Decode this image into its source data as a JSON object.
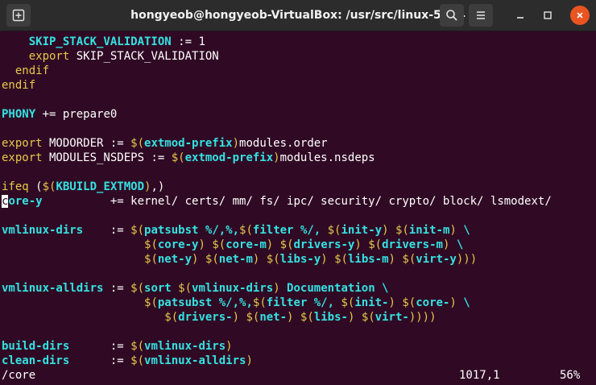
{
  "window": {
    "title": "hongyeob@hongyeob-VirtualBox: /usr/src/linux-5.6.4",
    "icons": [
      "terminal-new-tab-icon",
      "search-icon",
      "menu-icon",
      "minimize-icon",
      "maximize-icon",
      "close-icon"
    ]
  },
  "lines": [
    {
      "segs": [
        {
          "t": "    "
        },
        {
          "t": "SKIP_STACK_VALIDATION",
          "c": "cy"
        },
        {
          "t": " := 1"
        }
      ]
    },
    {
      "segs": [
        {
          "t": "    "
        },
        {
          "t": "export",
          "c": "yl"
        },
        {
          "t": " SKIP_STACK_VALIDATION"
        }
      ]
    },
    {
      "segs": [
        {
          "t": "  "
        },
        {
          "t": "endif",
          "c": "yl"
        }
      ]
    },
    {
      "segs": [
        {
          "t": "endif",
          "c": "yl"
        }
      ]
    },
    {
      "segs": [
        {
          "t": ""
        }
      ]
    },
    {
      "segs": [
        {
          "t": "PHONY",
          "c": "cy"
        },
        {
          "t": " += prepare0"
        }
      ]
    },
    {
      "segs": [
        {
          "t": ""
        }
      ]
    },
    {
      "segs": [
        {
          "t": "export",
          "c": "yl"
        },
        {
          "t": " MODORDER := "
        },
        {
          "t": "$(",
          "c": "yl"
        },
        {
          "t": "extmod-prefix",
          "c": "cy"
        },
        {
          "t": ")",
          "c": "yl"
        },
        {
          "t": "modules.order"
        }
      ]
    },
    {
      "segs": [
        {
          "t": "export",
          "c": "yl"
        },
        {
          "t": " MODULES_NSDEPS := "
        },
        {
          "t": "$(",
          "c": "yl"
        },
        {
          "t": "extmod-prefix",
          "c": "cy"
        },
        {
          "t": ")",
          "c": "yl"
        },
        {
          "t": "modules.nsdeps"
        }
      ]
    },
    {
      "segs": [
        {
          "t": ""
        }
      ]
    },
    {
      "segs": [
        {
          "t": "ifeq",
          "c": "yl"
        },
        {
          "t": " ("
        },
        {
          "t": "$(",
          "c": "yl"
        },
        {
          "t": "KBUILD_EXTMOD",
          "c": "cy"
        },
        {
          "t": ")",
          "c": "yl"
        },
        {
          "t": ",)"
        }
      ]
    },
    {
      "segs": [
        {
          "t": "c",
          "c": "cursor"
        },
        {
          "t": "ore-y",
          "c": "cy"
        },
        {
          "t": "          += kernel/ certs/ mm/ fs/ ipc/ security/ crypto/ block/ lsmodext/"
        }
      ]
    },
    {
      "segs": [
        {
          "t": ""
        }
      ]
    },
    {
      "segs": [
        {
          "t": "vmlinux-dirs",
          "c": "cy"
        },
        {
          "t": "    := "
        },
        {
          "t": "$(",
          "c": "yl"
        },
        {
          "t": "patsubst %/,%,",
          "c": "cy"
        },
        {
          "t": "$(",
          "c": "yl"
        },
        {
          "t": "filter %/, ",
          "c": "cy"
        },
        {
          "t": "$(",
          "c": "yl"
        },
        {
          "t": "init-y",
          "c": "cy"
        },
        {
          "t": ")",
          "c": "yl"
        },
        {
          "t": " "
        },
        {
          "t": "$(",
          "c": "yl"
        },
        {
          "t": "init-m",
          "c": "cy"
        },
        {
          "t": ")",
          "c": "yl"
        },
        {
          "t": " \\",
          "c": "cy"
        }
      ]
    },
    {
      "segs": [
        {
          "t": "                     "
        },
        {
          "t": "$(",
          "c": "yl"
        },
        {
          "t": "core-y",
          "c": "cy"
        },
        {
          "t": ")",
          "c": "yl"
        },
        {
          "t": " "
        },
        {
          "t": "$(",
          "c": "yl"
        },
        {
          "t": "core-m",
          "c": "cy"
        },
        {
          "t": ")",
          "c": "yl"
        },
        {
          "t": " "
        },
        {
          "t": "$(",
          "c": "yl"
        },
        {
          "t": "drivers-y",
          "c": "cy"
        },
        {
          "t": ")",
          "c": "yl"
        },
        {
          "t": " "
        },
        {
          "t": "$(",
          "c": "yl"
        },
        {
          "t": "drivers-m",
          "c": "cy"
        },
        {
          "t": ")",
          "c": "yl"
        },
        {
          "t": " \\",
          "c": "cy"
        }
      ]
    },
    {
      "segs": [
        {
          "t": "                     "
        },
        {
          "t": "$(",
          "c": "yl"
        },
        {
          "t": "net-y",
          "c": "cy"
        },
        {
          "t": ")",
          "c": "yl"
        },
        {
          "t": " "
        },
        {
          "t": "$(",
          "c": "yl"
        },
        {
          "t": "net-m",
          "c": "cy"
        },
        {
          "t": ")",
          "c": "yl"
        },
        {
          "t": " "
        },
        {
          "t": "$(",
          "c": "yl"
        },
        {
          "t": "libs-y",
          "c": "cy"
        },
        {
          "t": ")",
          "c": "yl"
        },
        {
          "t": " "
        },
        {
          "t": "$(",
          "c": "yl"
        },
        {
          "t": "libs-m",
          "c": "cy"
        },
        {
          "t": ")",
          "c": "yl"
        },
        {
          "t": " "
        },
        {
          "t": "$(",
          "c": "yl"
        },
        {
          "t": "virt-y",
          "c": "cy"
        },
        {
          "t": ")))",
          "c": "yl"
        }
      ]
    },
    {
      "segs": [
        {
          "t": ""
        }
      ]
    },
    {
      "segs": [
        {
          "t": "vmlinux-alldirs",
          "c": "cy"
        },
        {
          "t": " := "
        },
        {
          "t": "$(",
          "c": "yl"
        },
        {
          "t": "sort ",
          "c": "cy"
        },
        {
          "t": "$(",
          "c": "yl"
        },
        {
          "t": "vmlinux-dirs",
          "c": "cy"
        },
        {
          "t": ")",
          "c": "yl"
        },
        {
          "t": " Documentation \\",
          "c": "cy"
        }
      ]
    },
    {
      "segs": [
        {
          "t": "                     "
        },
        {
          "t": "$(",
          "c": "yl"
        },
        {
          "t": "patsubst %/,%,",
          "c": "cy"
        },
        {
          "t": "$(",
          "c": "yl"
        },
        {
          "t": "filter %/, ",
          "c": "cy"
        },
        {
          "t": "$(",
          "c": "yl"
        },
        {
          "t": "init-",
          "c": "cy"
        },
        {
          "t": ")",
          "c": "yl"
        },
        {
          "t": " "
        },
        {
          "t": "$(",
          "c": "yl"
        },
        {
          "t": "core-",
          "c": "cy"
        },
        {
          "t": ")",
          "c": "yl"
        },
        {
          "t": " \\",
          "c": "cy"
        }
      ]
    },
    {
      "segs": [
        {
          "t": "                        "
        },
        {
          "t": "$(",
          "c": "yl"
        },
        {
          "t": "drivers-",
          "c": "cy"
        },
        {
          "t": ")",
          "c": "yl"
        },
        {
          "t": " "
        },
        {
          "t": "$(",
          "c": "yl"
        },
        {
          "t": "net-",
          "c": "cy"
        },
        {
          "t": ")",
          "c": "yl"
        },
        {
          "t": " "
        },
        {
          "t": "$(",
          "c": "yl"
        },
        {
          "t": "libs-",
          "c": "cy"
        },
        {
          "t": ")",
          "c": "yl"
        },
        {
          "t": " "
        },
        {
          "t": "$(",
          "c": "yl"
        },
        {
          "t": "virt-",
          "c": "cy"
        },
        {
          "t": "))))",
          "c": "yl"
        }
      ]
    },
    {
      "segs": [
        {
          "t": ""
        }
      ]
    },
    {
      "segs": [
        {
          "t": "build-dirs",
          "c": "cy"
        },
        {
          "t": "      := "
        },
        {
          "t": "$(",
          "c": "yl"
        },
        {
          "t": "vmlinux-dirs",
          "c": "cy"
        },
        {
          "t": ")",
          "c": "yl"
        }
      ]
    },
    {
      "segs": [
        {
          "t": "clean-dirs",
          "c": "cy"
        },
        {
          "t": "      := "
        },
        {
          "t": "$(",
          "c": "yl"
        },
        {
          "t": "vmlinux-alldirs",
          "c": "cy"
        },
        {
          "t": ")",
          "c": "yl"
        }
      ]
    }
  ],
  "status": {
    "command": "/core",
    "position": "1017,1",
    "percent": "56%"
  },
  "colors": {
    "background": "#300a24",
    "cyan": "#34e2e2",
    "yellow": "#e6c84a",
    "close": "#e95420"
  }
}
